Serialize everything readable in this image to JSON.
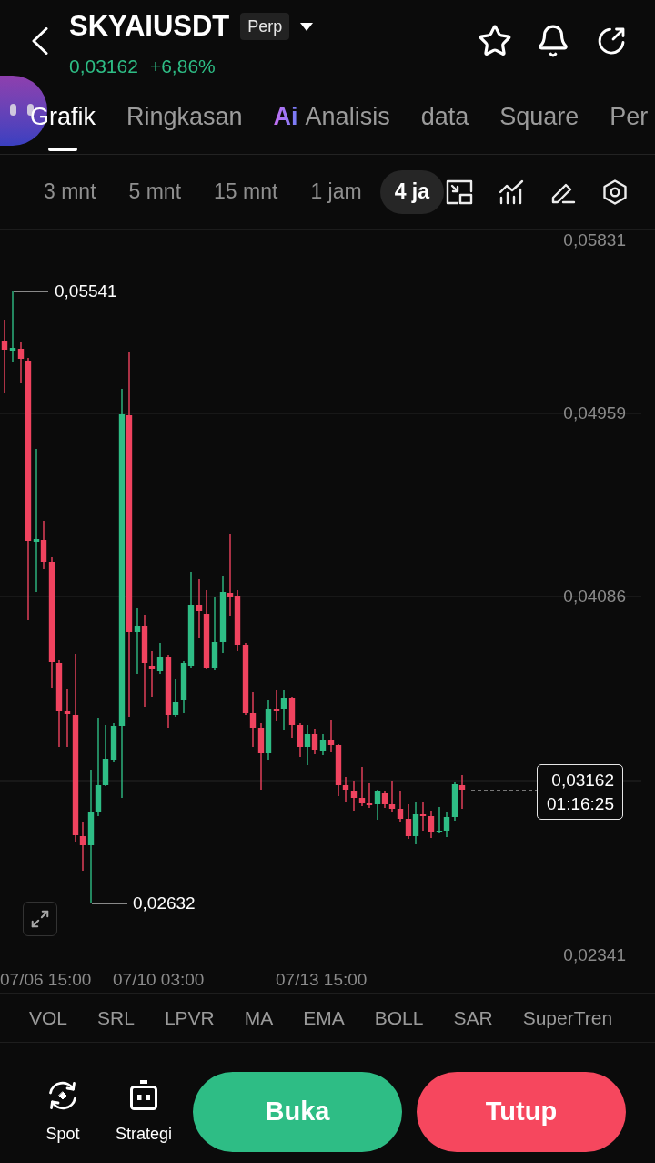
{
  "header": {
    "symbol": "SKYAIUSDT",
    "contract_badge": "Perp",
    "last_price": "0,03162",
    "change": "+6,86%"
  },
  "tabs": [
    {
      "label": "Grafik",
      "selected": true
    },
    {
      "label": "Ringkasan",
      "selected": false
    },
    {
      "badge": "Ai",
      "label": "Analisis",
      "selected": false
    },
    {
      "label": "data",
      "selected": false
    },
    {
      "label": "Square",
      "selected": false
    },
    {
      "label": "Per",
      "selected": false
    }
  ],
  "intervals": [
    {
      "label": "3 mnt",
      "selected": false
    },
    {
      "label": "5 mnt",
      "selected": false
    },
    {
      "label": "15 mnt",
      "selected": false
    },
    {
      "label": "1 jam",
      "selected": false
    },
    {
      "label": "4 ja",
      "selected": true
    }
  ],
  "chart": {
    "y_axis_labels": [
      "0,05831",
      "0,04959",
      "0,04086",
      "0,02341"
    ],
    "x_axis_labels": [
      "07/06 15:00",
      "07/10 03:00",
      "07/13 15:00"
    ],
    "high_label": "0,05541",
    "low_label": "0,02632",
    "last_price": "0,03162",
    "countdown": "01:16:25"
  },
  "indicators": [
    "VOL",
    "SRL",
    "LPVR",
    "MA",
    "EMA",
    "BOLL",
    "SAR",
    "SuperTren"
  ],
  "bottom_bar": {
    "shortcuts": [
      "Spot",
      "Strategi"
    ],
    "buttons": [
      {
        "label": "Buka",
        "kind": "buy"
      },
      {
        "label": "Tutup",
        "kind": "sell"
      }
    ]
  }
}
